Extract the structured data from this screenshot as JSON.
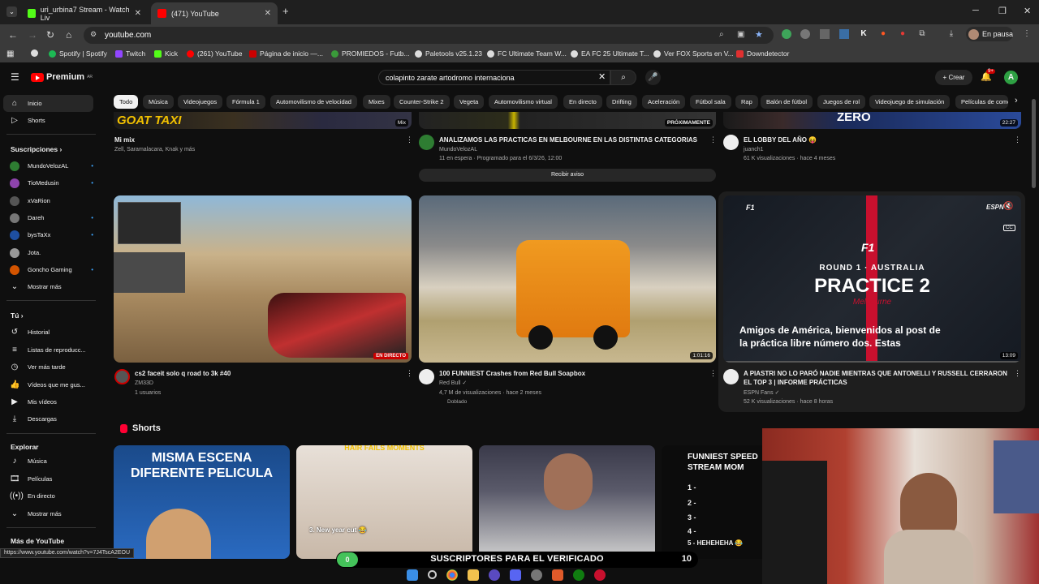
{
  "browser": {
    "tabs": [
      {
        "title": "uri_urbina7 Stream - Watch Liv",
        "icon": "kick-icon",
        "color": "#53fc18",
        "active": false
      },
      {
        "title": "(471) YouTube",
        "icon": "youtube-icon",
        "color": "#ff0000",
        "active": true
      }
    ],
    "new_tab": "+",
    "url": "youtube.com",
    "profile_status": "En pausa",
    "bookmarks": [
      {
        "label": "Spotify | Spotify",
        "color": "#1db954"
      },
      {
        "label": "Twitch",
        "color": "#9146ff"
      },
      {
        "label": "Kick",
        "color": "#53fc18"
      },
      {
        "label": "(261) YouTube",
        "color": "#ff0000"
      },
      {
        "label": "Página de inicio —...",
        "color": "#cc0000"
      },
      {
        "label": "PROMIEDOS - Futb...",
        "color": "#3a9a3a"
      },
      {
        "label": "Paletools v25.1.23",
        "color": "#dddddd"
      },
      {
        "label": "FC Ultimate Team W...",
        "color": "#dddddd"
      },
      {
        "label": "EA FC 25 Ultimate T...",
        "color": "#dddddd"
      },
      {
        "label": "Ver FOX Sports en V...",
        "color": "#dddddd"
      },
      {
        "label": "Downdetector",
        "color": "#e03030"
      }
    ]
  },
  "youtube": {
    "logo_text": "Premium",
    "logo_region": "AR",
    "search_query": "colapinto zarate artodromo internaciona",
    "create_label": "Crear",
    "notif_count": "9+",
    "account_initial": "A",
    "chips": [
      "Todo",
      "Música",
      "Videojuegos",
      "Fórmula 1",
      "Automovilismo de velocidad",
      "Mixes",
      "Counter-Strike 2",
      "Vegeta",
      "Automovilismo virtual",
      "En directo",
      "Drifting",
      "Aceleración",
      "Fútbol sala",
      "Rap",
      "Balón de fútbol",
      "Juegos de rol",
      "Videojuego de simulación",
      "Películas de come"
    ],
    "sidebar": {
      "main": [
        {
          "label": "Inicio",
          "icon": "home-icon"
        },
        {
          "label": "Shorts",
          "icon": "shorts-icon"
        }
      ],
      "subs_heading": "Suscripciones",
      "subs": [
        {
          "label": "MundoVelozAL",
          "color": "#2e7d32"
        },
        {
          "label": "TioMedusin",
          "color": "#8e44ad"
        },
        {
          "label": "xVaRion",
          "color": "#555555"
        },
        {
          "label": "Dareh",
          "color": "#777777"
        },
        {
          "label": "bysTaXx",
          "color": "#1e4fa0"
        },
        {
          "label": "Jota.",
          "color": "#999999"
        },
        {
          "label": "Goncho Gaming",
          "color": "#d35400"
        }
      ],
      "show_more": "Mostrar más",
      "you_heading": "Tú",
      "you": [
        {
          "label": "Historial",
          "icon": "history-icon"
        },
        {
          "label": "Listas de reproducc...",
          "icon": "playlist-icon"
        },
        {
          "label": "Ver más tarde",
          "icon": "clock-icon"
        },
        {
          "label": "Vídeos que me gus...",
          "icon": "like-icon"
        },
        {
          "label": "Mis vídeos",
          "icon": "video-icon"
        },
        {
          "label": "Descargas",
          "icon": "download-icon"
        }
      ],
      "explore_heading": "Explorar",
      "explore": [
        {
          "label": "Música",
          "icon": "music-icon"
        },
        {
          "label": "Películas",
          "icon": "film-icon"
        },
        {
          "label": "En directo",
          "icon": "live-icon"
        },
        {
          "label": "Mostrar más",
          "icon": "chevron-down-icon"
        }
      ],
      "more_heading": "Más de YouTube"
    },
    "row1": [
      {
        "title": "Mi mix",
        "meta1": "Zell, Saramalacara, Knak y más",
        "meta2": "",
        "thumb_text": "GOAT TAXI",
        "badge": "Mix"
      },
      {
        "title": "ANALIZAMOS LAS PRACTICAS EN MELBOURNE EN LAS DISTINTAS CATEGORIAS",
        "meta1": "MundoVelozAL",
        "meta2": "11 en espera · Programado para el 6/3/26, 12:00",
        "badge": "PRÓXIMAMENTE",
        "button": "Recibir aviso"
      },
      {
        "title": "EL LOBBY DEL AÑO 😝",
        "meta1": "juanch1",
        "meta2": "61 K visualizaciones · hace 4 meses",
        "badge": "22:27",
        "thumb_text": "ZERO"
      }
    ],
    "row2": [
      {
        "title": "cs2 faceit solo q road to 3k #40",
        "meta1": "ZM33D",
        "meta2": "1 usuarios",
        "badge": "EN DIRECTO"
      },
      {
        "title": "100 FUNNIEST Crashes from Red Bull Soapbox",
        "meta1": "Red Bull",
        "meta2": "4,7 M de visualizaciones · hace 2 meses",
        "meta3": "Doblado",
        "badge": "1:01:16"
      },
      {
        "title": "A PIASTRI NO LO PARÓ NADIE MIENTRAS QUE ANTONELLI Y RUSSELL CERRARON EL TOP 3 | INFORME PRÁCTICAS",
        "meta1": "ESPN Fans",
        "meta2": "52 K visualizaciones · hace 8 horas",
        "badge": "13:09",
        "preview": {
          "brand": "F1",
          "round": "ROUND 1 · AUSTRALIA",
          "session": "PRACTICE 2",
          "city": "Melbourne",
          "caption": "Amigos de América, bienvenidos al post de la práctica libre número dos. Estas",
          "net": "ESPN",
          "cc": "CC"
        }
      }
    ],
    "shorts_heading": "Shorts",
    "shorts": [
      {
        "text": "MISMA ESCENA DIFERENTE PELICULA"
      },
      {
        "text": "HAIR FAILS MOMENTS",
        "sub": "3. New year cut 😂"
      },
      {
        "text": ""
      },
      {
        "text": "FUNNIEST SPEED STREAM MOM",
        "list": [
          "1 -",
          "2 -",
          "3 -",
          "4 -",
          "5 - HEHEHEHA 😂"
        ]
      }
    ]
  },
  "overlay": {
    "status_url": "https://www.youtube.com/watch?v=7J4TscA2EOU",
    "sub_label": "SUSCRIPTORES PARA EL VERIFICADO",
    "sub_current": "0",
    "sub_goal": "10",
    "sub_progress": 0.0
  }
}
